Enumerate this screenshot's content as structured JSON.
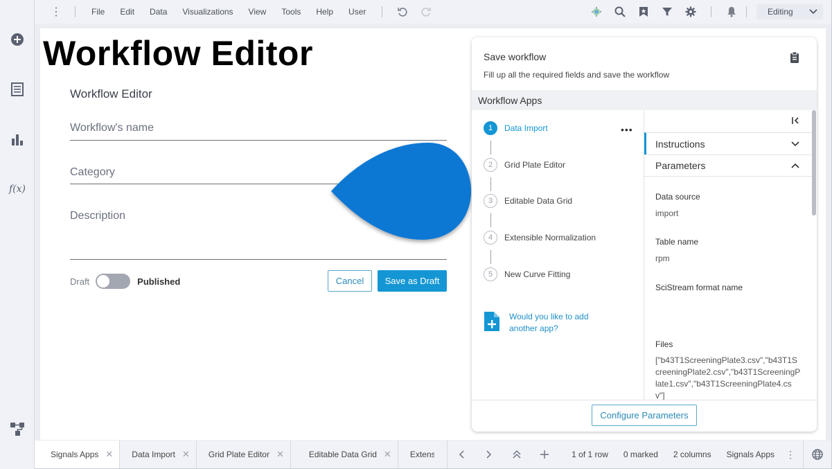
{
  "menubar": {
    "items": [
      "File",
      "Edit",
      "Data",
      "Visualizations",
      "View",
      "Tools",
      "Help",
      "User"
    ],
    "mode": "Editing"
  },
  "page": {
    "big_title": "Workflow Editor"
  },
  "form": {
    "heading": "Workflow Editor",
    "name_placeholder": "Workflow's name",
    "category_placeholder": "Category",
    "description_placeholder": "Description",
    "draft_label": "Draft",
    "published_label": "Published",
    "cancel_label": "Cancel",
    "save_label": "Save as Draft"
  },
  "panel": {
    "title": "Save workflow",
    "subtitle": "Fill up all the required fields and save the workflow",
    "apps_header": "Workflow Apps",
    "steps": [
      {
        "num": "1",
        "label": "Data Import"
      },
      {
        "num": "2",
        "label": "Grid Plate Editor"
      },
      {
        "num": "3",
        "label": "Editable Data Grid"
      },
      {
        "num": "4",
        "label": "Extensible Normalization"
      },
      {
        "num": "5",
        "label": "New Curve Fitting"
      }
    ],
    "more_label": "•••",
    "add_app_text": "Would you like to add another app?",
    "instructions_label": "Instructions",
    "parameters_label": "Parameters",
    "fields": [
      {
        "label": "Data source",
        "value": "import"
      },
      {
        "label": "Table name",
        "value": "rpm"
      },
      {
        "label": "SciStream format name",
        "value": ""
      },
      {
        "label": "Files",
        "value": "[\"b43T1ScreeningPlate3.csv\",\"b43T1ScreeningPlate2.csv\",\"b43T1ScreeningPlate1.csv\",\"b43T1ScreeningPlate4.csv\"]"
      }
    ],
    "configure_label": "Configure Parameters"
  },
  "bottombar": {
    "tabs": [
      "Signals Apps",
      "Data Import",
      "Grid Plate Editor",
      "Editable Data Grid",
      "Extensi"
    ],
    "rows": "1 of 1 row",
    "marked": "0 marked",
    "columns": "2 columns",
    "app": "Signals Apps"
  },
  "colors": {
    "accent": "#1496d4",
    "drop_shape": "#0a78d4"
  }
}
